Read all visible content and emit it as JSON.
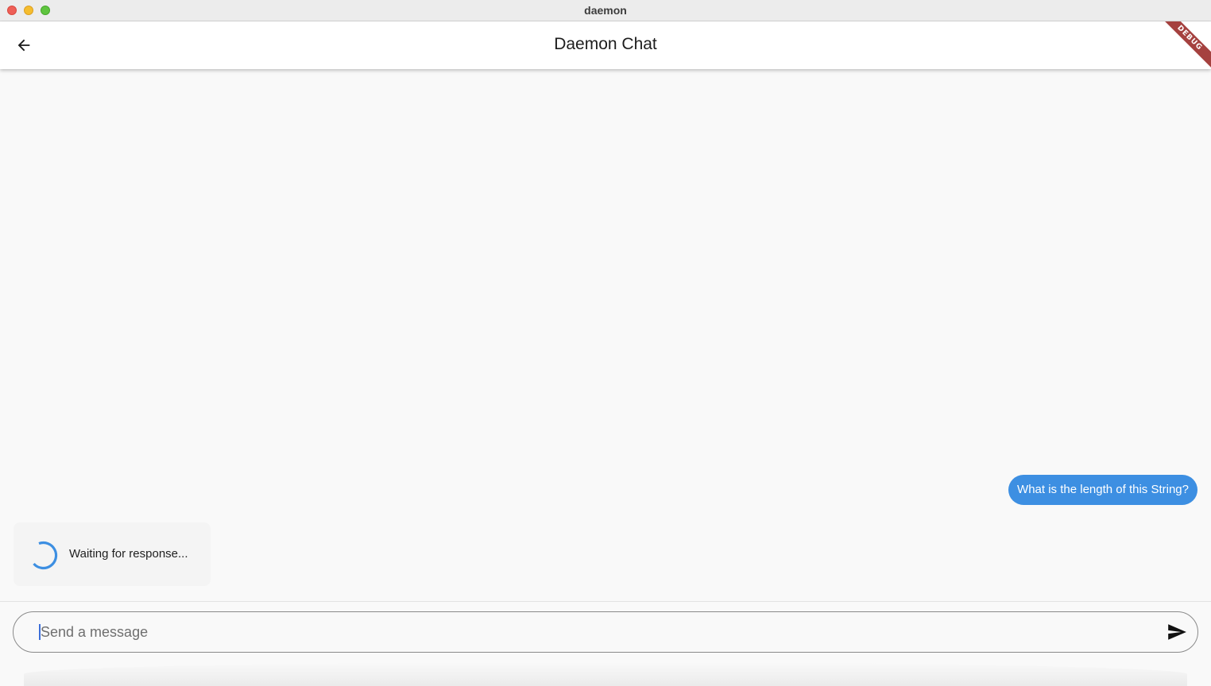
{
  "window": {
    "title": "daemon"
  },
  "appbar": {
    "title": "Daemon Chat",
    "back_icon": "arrow-left-icon"
  },
  "debug_banner": {
    "label": "DEBUG",
    "color": "#a5413f"
  },
  "messages": [
    {
      "role": "user",
      "text": "What is the length of this String?",
      "bubble_color": "#3d8fe2"
    }
  ],
  "status": {
    "text": "Waiting for response...",
    "icon": "loading-spinner-icon"
  },
  "composer": {
    "placeholder": "Send a message",
    "value": "",
    "send_icon": "send-icon"
  },
  "colors": {
    "accent": "#3d8fe2",
    "background": "#f9f9f9",
    "appbar": "#ffffff"
  }
}
